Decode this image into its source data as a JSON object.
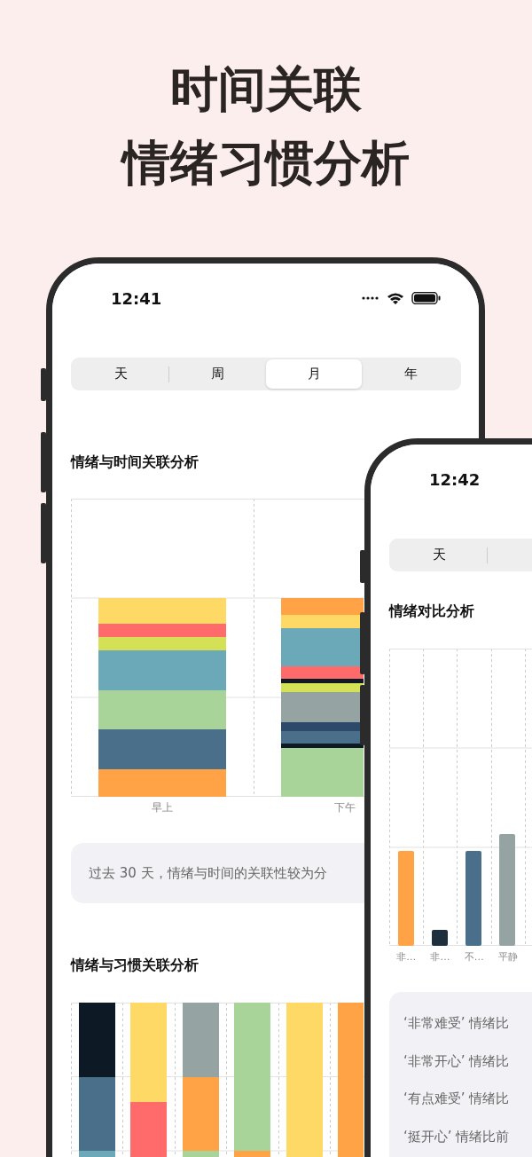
{
  "headline": [
    "时间关联",
    "情绪习惯分析"
  ],
  "phone_1": {
    "time": "12:41",
    "tabs": [
      {
        "label": "天",
        "selected": false
      },
      {
        "label": "周",
        "selected": false
      },
      {
        "label": "月",
        "selected": true
      },
      {
        "label": "年",
        "selected": false
      }
    ],
    "time_chart": {
      "title": "情绪与时间关联分析",
      "x_labels": [
        "早上",
        "下午"
      ]
    },
    "note": "过去 30 天，情绪与时间的关联性较为分",
    "habit_chart": {
      "title": "情绪与习惯关联分析"
    }
  },
  "phone_2": {
    "time": "12:42",
    "tabs": [
      {
        "label": "天",
        "selected": false
      }
    ],
    "compare_chart": {
      "title": "情绪对比分析",
      "x_labels": [
        "非…",
        "非…",
        "不…",
        "平静"
      ]
    },
    "notes": [
      "‘非常难受’ 情绪比",
      "‘非常开心’ 情绪比",
      "‘有点难受’ 情绪比",
      "‘挺开心’ 情绪比前"
    ]
  }
}
